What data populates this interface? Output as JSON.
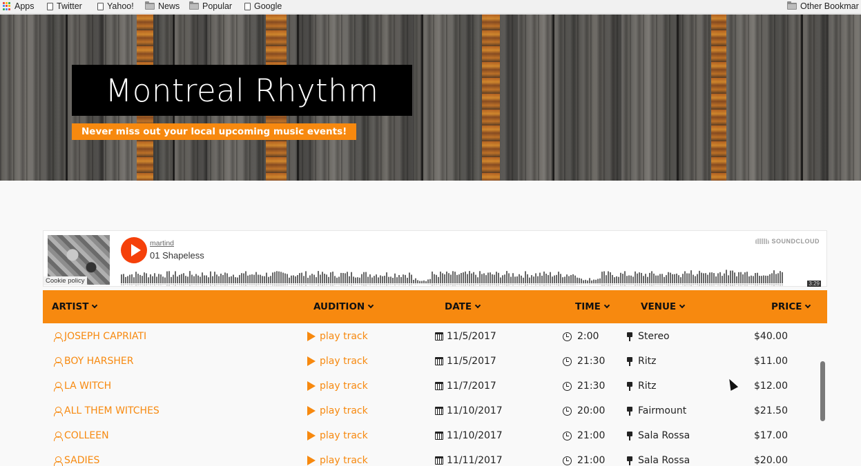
{
  "bookmarks": {
    "apps": "Apps",
    "items": [
      {
        "label": "Twitter",
        "icon": "page-icon"
      },
      {
        "label": "Yahoo!",
        "icon": "page-icon"
      },
      {
        "label": "News",
        "icon": "folder-icon"
      },
      {
        "label": "Popular",
        "icon": "folder-icon"
      },
      {
        "label": "Google",
        "icon": "page-icon"
      }
    ],
    "other": "Other Bookmar"
  },
  "hero": {
    "title": "Montreal Rhythm",
    "tagline": "Never miss out your local upcoming music events!"
  },
  "player": {
    "user": "martind",
    "track": "01 Shapeless",
    "brand": "SOUNDCLOUD",
    "cookie": "Cookie policy",
    "duration": "3:29"
  },
  "table": {
    "headers": {
      "artist": "ARTIST",
      "audition": "AUDITION",
      "date": "DATE",
      "time": "TIME",
      "venue": "VENUE",
      "price": "PRICE"
    },
    "rows": [
      {
        "artist": "JOSEPH CAPRIATI",
        "audition": "play track",
        "date": "11/5/2017",
        "time": "2:00",
        "venue": "Stereo",
        "price": "$40.00"
      },
      {
        "artist": "BOY HARSHER",
        "audition": "play track",
        "date": "11/5/2017",
        "time": "21:30",
        "venue": "Ritz",
        "price": "$11.00"
      },
      {
        "artist": "LA WITCH",
        "audition": "play track",
        "date": "11/7/2017",
        "time": "21:30",
        "venue": "Ritz",
        "price": "$12.00"
      },
      {
        "artist": "ALL THEM WITCHES",
        "audition": "play track",
        "date": "11/10/2017",
        "time": "20:00",
        "venue": "Fairmount",
        "price": "$21.50"
      },
      {
        "artist": "COLLEEN",
        "audition": "play track",
        "date": "11/10/2017",
        "time": "21:00",
        "venue": "Sala Rossa",
        "price": "$17.00"
      },
      {
        "artist": "SADIES",
        "audition": "play track",
        "date": "11/11/2017",
        "time": "21:00",
        "venue": "Sala Rossa",
        "price": "$20.00"
      }
    ]
  },
  "colors": {
    "accent": "#f7890f",
    "play": "#f5400a"
  }
}
